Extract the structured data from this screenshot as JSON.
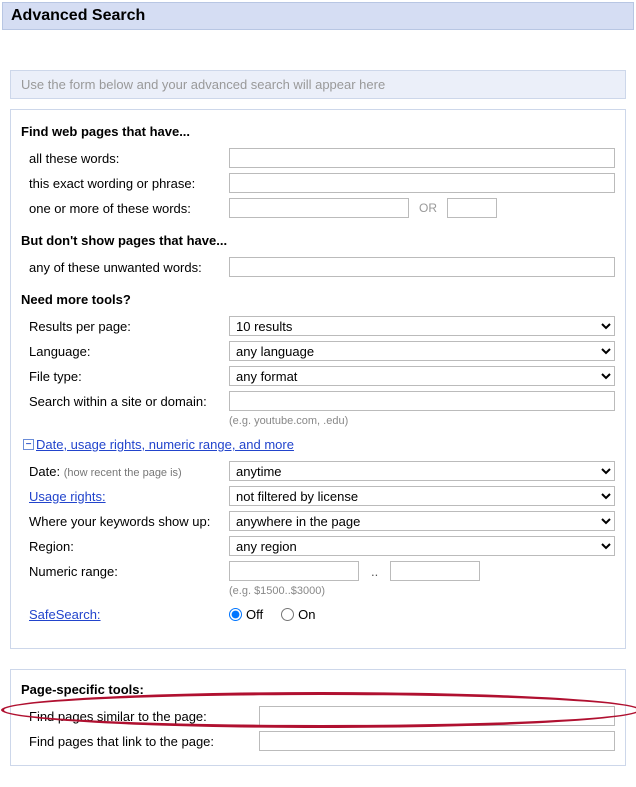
{
  "header": {
    "title": "Advanced Search"
  },
  "preview": {
    "placeholder": "Use the form below and your advanced search will appear here"
  },
  "sections": {
    "find": {
      "heading": "Find web pages that have...",
      "rows": {
        "all_words": {
          "label": "all these words:"
        },
        "exact_phrase": {
          "label": "this exact wording or phrase:"
        },
        "any_words": {
          "label": "one or more of these words:",
          "or": "OR"
        }
      }
    },
    "exclude": {
      "heading": "But don't show pages that have...",
      "rows": {
        "unwanted": {
          "label": "any of these unwanted words:"
        }
      }
    },
    "tools": {
      "heading": "Need more tools?",
      "rows": {
        "results": {
          "label": "Results per page:",
          "value": "10 results"
        },
        "language": {
          "label": "Language:",
          "value": "any language"
        },
        "filetype": {
          "label": "File type:",
          "value": "any format"
        },
        "domain": {
          "label": "Search within a site or domain:",
          "hint": "(e.g. youtube.com, .edu)"
        }
      }
    },
    "expand": {
      "link": "Date, usage rights, numeric range, and more"
    },
    "more": {
      "rows": {
        "date": {
          "label": "Date:",
          "sublabel": "(how recent the page is)",
          "value": "anytime"
        },
        "usage": {
          "label": "Usage rights:",
          "value": "not filtered by license"
        },
        "where": {
          "label": "Where your keywords show up:",
          "value": "anywhere in the page"
        },
        "region": {
          "label": "Region:",
          "value": "any region"
        },
        "numeric": {
          "label": "Numeric range:",
          "hint": "(e.g. $1500..$3000)",
          "sep": ".."
        },
        "safesearch": {
          "label": "SafeSearch:",
          "off": "Off",
          "on": "On"
        }
      }
    }
  },
  "page_tools": {
    "heading": "Page-specific tools:",
    "rows": {
      "similar": {
        "label": "Find pages similar to the page:"
      },
      "linkto": {
        "label": "Find pages that link to the page:"
      }
    }
  }
}
